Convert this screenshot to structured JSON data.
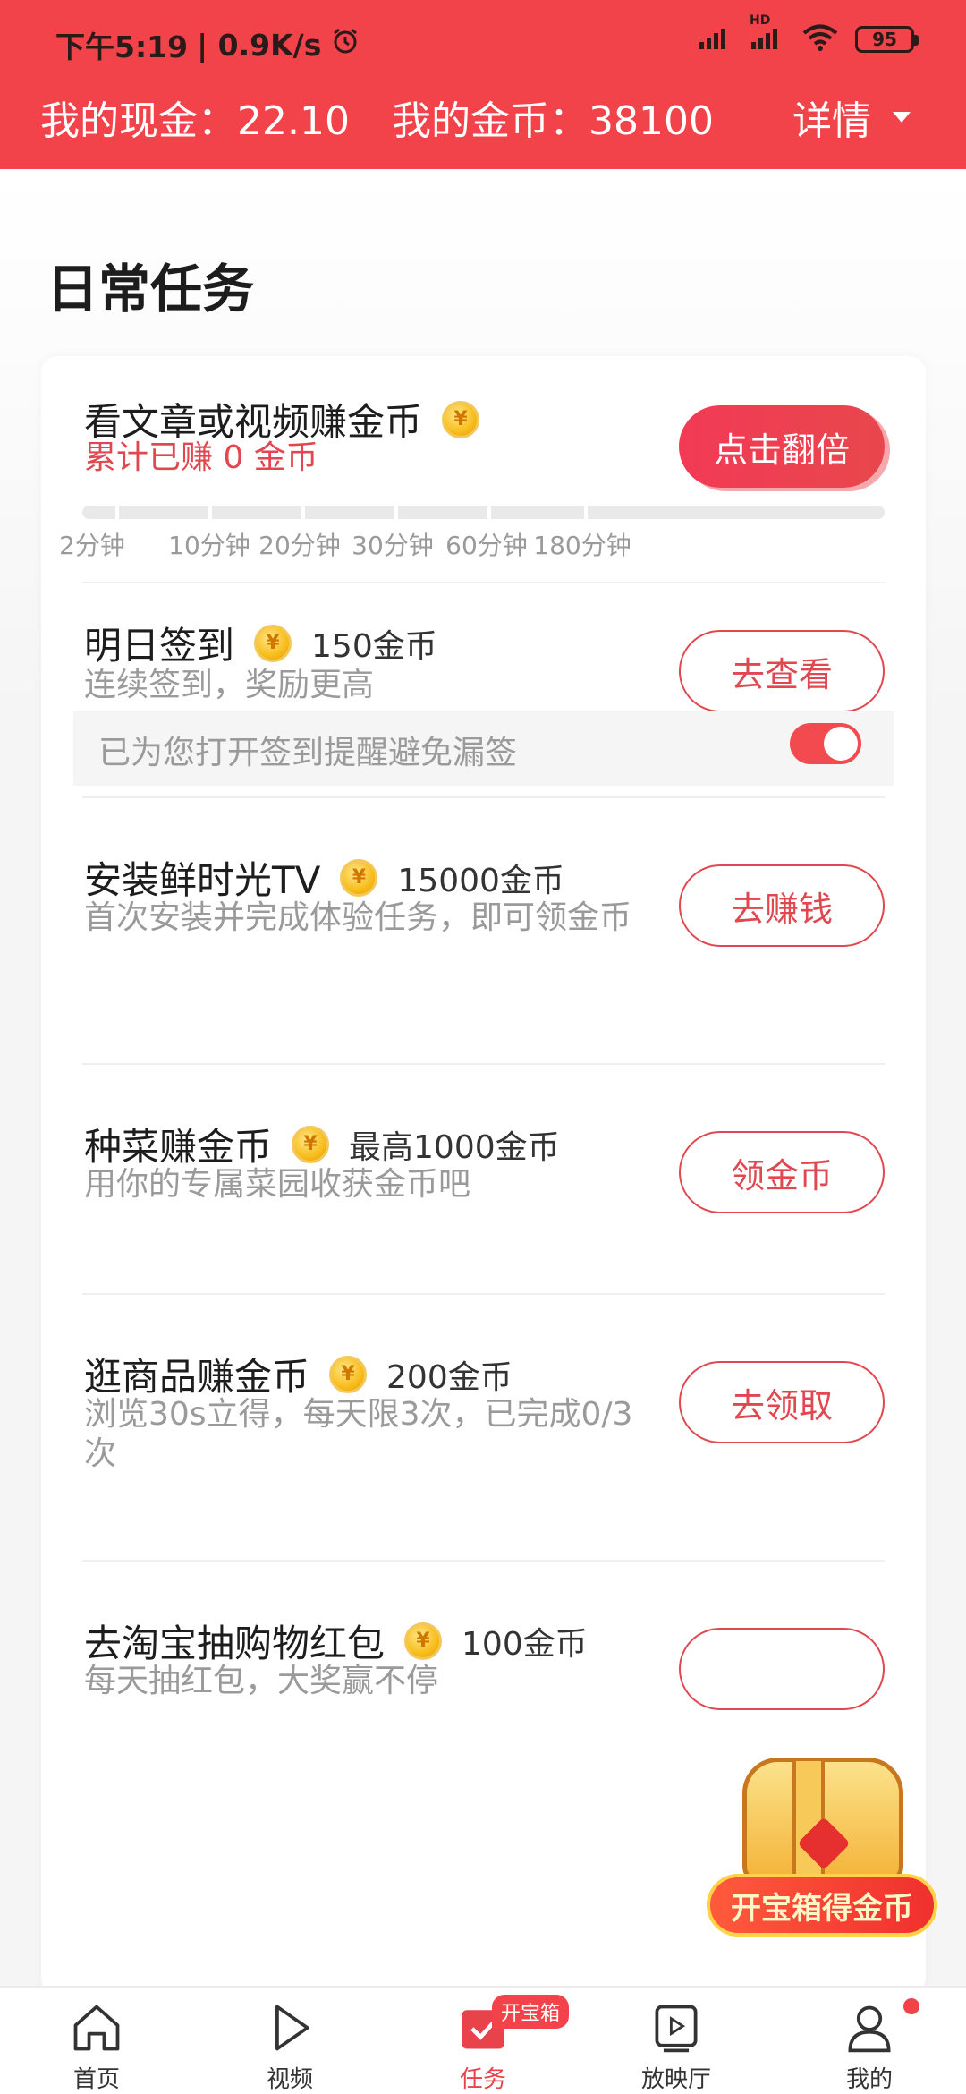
{
  "status_bar": {
    "time": "下午5:19",
    "speed": "| 0.9K/s",
    "battery": "95",
    "network": "HD"
  },
  "wallet": {
    "cash": "我的现金：22.10",
    "coins": "我的金币：38100",
    "detail": "详情"
  },
  "section_title": "日常任务",
  "tasks": [
    {
      "title": "看文章或视频赚金币",
      "earned": "累计已赚 0 金币",
      "button": "点击翻倍",
      "progress_labels": [
        "2分钟",
        "10分钟",
        "20分钟",
        "30分钟",
        "60分钟",
        "180分钟"
      ],
      "progress": 0
    },
    {
      "title": "明日签到",
      "reward": "150金币",
      "subtitle": "连续签到，奖励更高",
      "button": "去查看",
      "reminder": "已为您打开签到提醒避免漏签",
      "reminder_on": true
    },
    {
      "title": "安装鲜时光TV",
      "reward": "15000金币",
      "subtitle": "首次安装并完成体验任务，即可领金币",
      "button": "去赚钱"
    },
    {
      "title": "种菜赚金币",
      "reward": "最高1000金币",
      "subtitle": "用你的专属菜园收获金币吧",
      "button": "领金币"
    },
    {
      "title": "逛商品赚金币",
      "reward": "200金币",
      "subtitle": "浏览30s立得，每天限3次，已完成0/3次",
      "button": "去领取"
    },
    {
      "title": "去淘宝抽购物红包",
      "reward": "100金币",
      "subtitle": "每天抽红包，大奖赢不停"
    }
  ],
  "treasure": {
    "label": "开宝箱得金币"
  },
  "coin_symbol": "¥",
  "nav": {
    "items": [
      {
        "label": "首页",
        "icon": "home-icon"
      },
      {
        "label": "视频",
        "icon": "play-icon"
      },
      {
        "label": "任务",
        "icon": "task-icon",
        "badge": "开宝箱",
        "active": true
      },
      {
        "label": "放映厅",
        "icon": "theater-icon"
      },
      {
        "label": "我的",
        "icon": "profile-icon"
      }
    ]
  },
  "colors": {
    "brand_red": "#f2434a",
    "accent_text_red": "#e0474f"
  }
}
